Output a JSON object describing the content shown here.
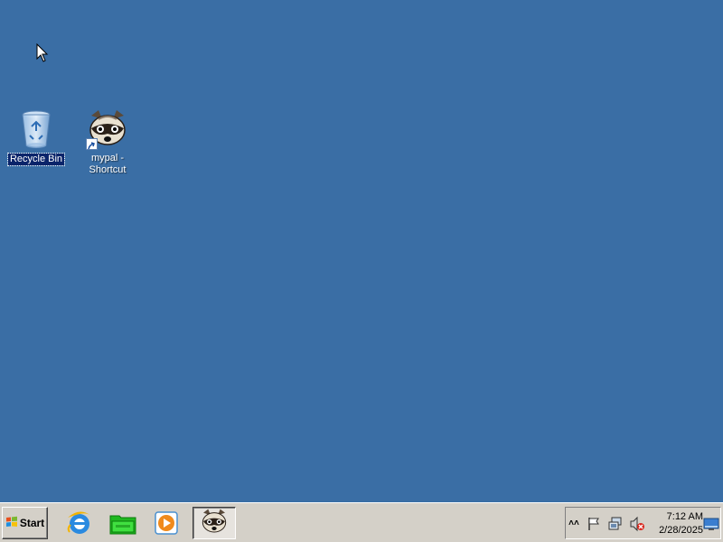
{
  "desktop": {
    "background_color": "#3a6ea5",
    "icons": [
      {
        "label": "Recycle Bin",
        "icon": "recycle-bin-icon",
        "selected": true
      },
      {
        "label": "mypal - Shortcut",
        "icon": "mypal-raccoon-icon",
        "selected": false
      }
    ]
  },
  "taskbar": {
    "start_label": "Start",
    "quick_launch": [
      {
        "icon": "internet-explorer-icon"
      },
      {
        "icon": "folder-explorer-icon"
      },
      {
        "icon": "media-player-icon"
      }
    ],
    "open_tasks": [
      {
        "icon": "mypal-raccoon-icon"
      }
    ],
    "tray": {
      "icons": [
        "expand-tray-icon",
        "action-center-flag-icon",
        "network-icon",
        "volume-muted-icon",
        "show-desktop-icon"
      ],
      "time": "7:12 AM",
      "date": "2/28/2025"
    }
  }
}
